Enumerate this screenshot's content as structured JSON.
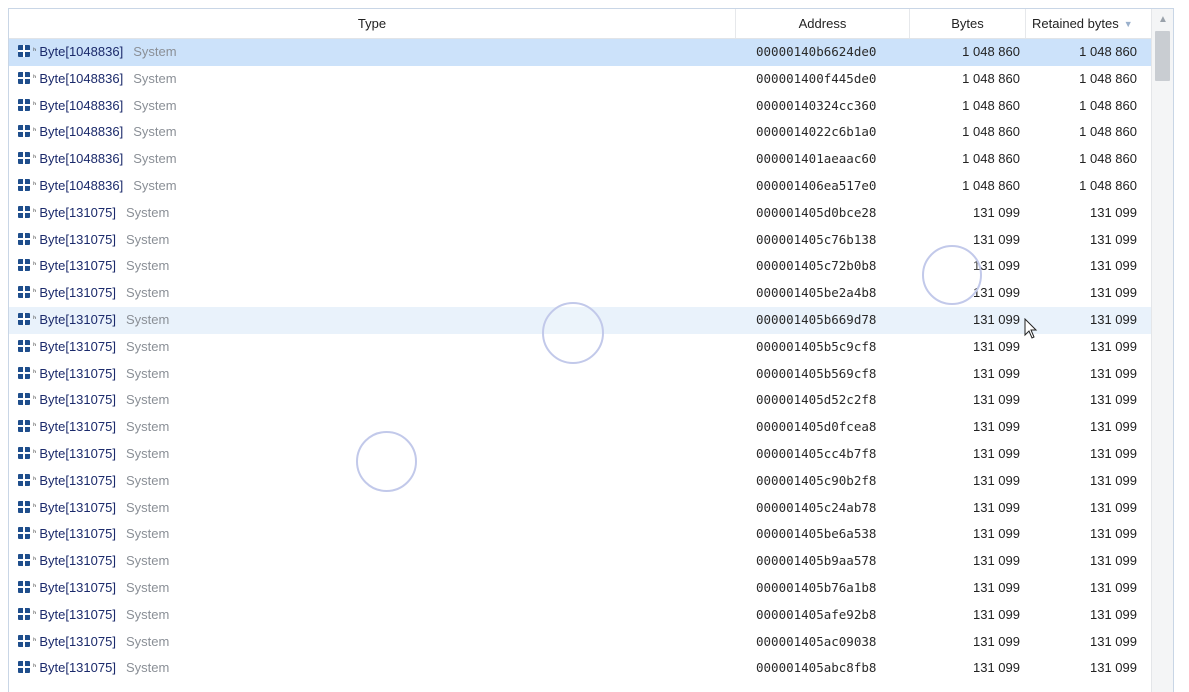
{
  "columns": {
    "type": "Type",
    "address": "Address",
    "bytes": "Bytes",
    "retained": "Retained bytes",
    "sort_icon": "sort-descending-icon"
  },
  "colors": {
    "selected_row": "#cce2fa",
    "hover_row": "#e9f2fb",
    "type_icon": "#1f4e8c",
    "namespace_text": "#8a8f96"
  },
  "rows": [
    {
      "type": "Byte[1048836]",
      "ns": "System",
      "address": "00000140b6624de0",
      "bytes": "1 048 860",
      "retained": "1 048 860",
      "state": "selected"
    },
    {
      "type": "Byte[1048836]",
      "ns": "System",
      "address": "000001400f445de0",
      "bytes": "1 048 860",
      "retained": "1 048 860",
      "state": ""
    },
    {
      "type": "Byte[1048836]",
      "ns": "System",
      "address": "00000140324cc360",
      "bytes": "1 048 860",
      "retained": "1 048 860",
      "state": ""
    },
    {
      "type": "Byte[1048836]",
      "ns": "System",
      "address": "0000014022c6b1a0",
      "bytes": "1 048 860",
      "retained": "1 048 860",
      "state": ""
    },
    {
      "type": "Byte[1048836]",
      "ns": "System",
      "address": "000001401aeaac60",
      "bytes": "1 048 860",
      "retained": "1 048 860",
      "state": ""
    },
    {
      "type": "Byte[1048836]",
      "ns": "System",
      "address": "000001406ea517e0",
      "bytes": "1 048 860",
      "retained": "1 048 860",
      "state": ""
    },
    {
      "type": "Byte[131075]",
      "ns": "System",
      "address": "000001405d0bce28",
      "bytes": "131 099",
      "retained": "131 099",
      "state": ""
    },
    {
      "type": "Byte[131075]",
      "ns": "System",
      "address": "000001405c76b138",
      "bytes": "131 099",
      "retained": "131 099",
      "state": ""
    },
    {
      "type": "Byte[131075]",
      "ns": "System",
      "address": "000001405c72b0b8",
      "bytes": "131 099",
      "retained": "131 099",
      "state": ""
    },
    {
      "type": "Byte[131075]",
      "ns": "System",
      "address": "000001405be2a4b8",
      "bytes": "131 099",
      "retained": "131 099",
      "state": ""
    },
    {
      "type": "Byte[131075]",
      "ns": "System",
      "address": "000001405b669d78",
      "bytes": "131 099",
      "retained": "131 099",
      "state": "hover"
    },
    {
      "type": "Byte[131075]",
      "ns": "System",
      "address": "000001405b5c9cf8",
      "bytes": "131 099",
      "retained": "131 099",
      "state": ""
    },
    {
      "type": "Byte[131075]",
      "ns": "System",
      "address": "000001405b569cf8",
      "bytes": "131 099",
      "retained": "131 099",
      "state": ""
    },
    {
      "type": "Byte[131075]",
      "ns": "System",
      "address": "000001405d52c2f8",
      "bytes": "131 099",
      "retained": "131 099",
      "state": ""
    },
    {
      "type": "Byte[131075]",
      "ns": "System",
      "address": "000001405d0fcea8",
      "bytes": "131 099",
      "retained": "131 099",
      "state": ""
    },
    {
      "type": "Byte[131075]",
      "ns": "System",
      "address": "000001405cc4b7f8",
      "bytes": "131 099",
      "retained": "131 099",
      "state": ""
    },
    {
      "type": "Byte[131075]",
      "ns": "System",
      "address": "000001405c90b2f8",
      "bytes": "131 099",
      "retained": "131 099",
      "state": ""
    },
    {
      "type": "Byte[131075]",
      "ns": "System",
      "address": "000001405c24ab78",
      "bytes": "131 099",
      "retained": "131 099",
      "state": ""
    },
    {
      "type": "Byte[131075]",
      "ns": "System",
      "address": "000001405be6a538",
      "bytes": "131 099",
      "retained": "131 099",
      "state": ""
    },
    {
      "type": "Byte[131075]",
      "ns": "System",
      "address": "000001405b9aa578",
      "bytes": "131 099",
      "retained": "131 099",
      "state": ""
    },
    {
      "type": "Byte[131075]",
      "ns": "System",
      "address": "000001405b76a1b8",
      "bytes": "131 099",
      "retained": "131 099",
      "state": ""
    },
    {
      "type": "Byte[131075]",
      "ns": "System",
      "address": "000001405afe92b8",
      "bytes": "131 099",
      "retained": "131 099",
      "state": ""
    },
    {
      "type": "Byte[131075]",
      "ns": "System",
      "address": "000001405ac09038",
      "bytes": "131 099",
      "retained": "131 099",
      "state": ""
    },
    {
      "type": "Byte[131075]",
      "ns": "System",
      "address": "000001405abc8fb8",
      "bytes": "131 099",
      "retained": "131 099",
      "state": ""
    }
  ]
}
